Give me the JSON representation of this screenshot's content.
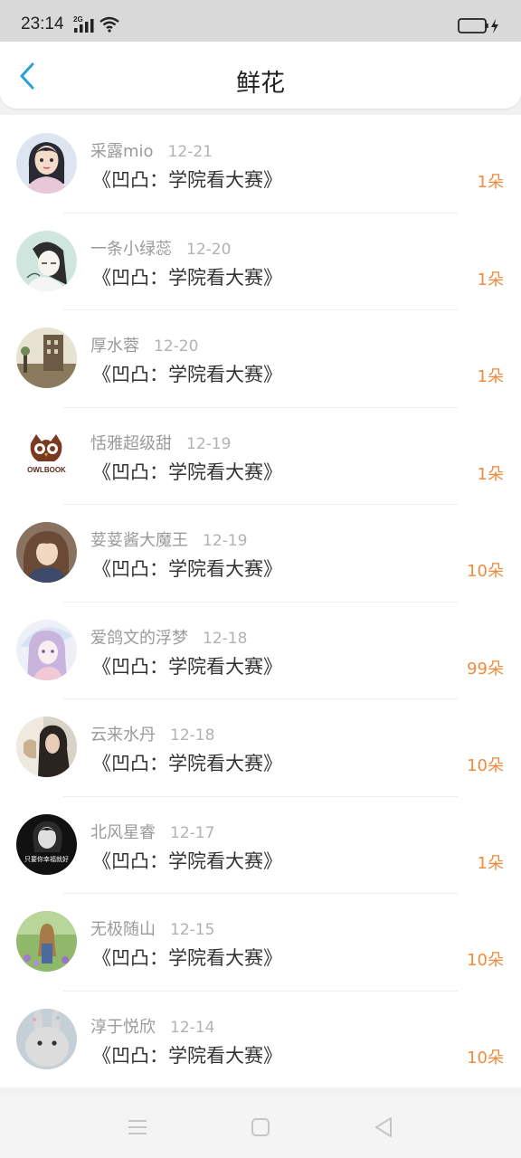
{
  "status_bar": {
    "time": "23:14",
    "network": "2G"
  },
  "header": {
    "title": "鲜花"
  },
  "items": [
    {
      "username": "采露mio",
      "date": "12-21",
      "work": "《凹凸：学院看大赛》",
      "count": "1朵"
    },
    {
      "username": "一条小绿蕊",
      "date": "12-20",
      "work": "《凹凸：学院看大赛》",
      "count": "1朵"
    },
    {
      "username": "厚水蓉",
      "date": "12-20",
      "work": "《凹凸：学院看大赛》",
      "count": "1朵"
    },
    {
      "username": "恬雅超级甜",
      "date": "12-19",
      "work": "《凹凸：学院看大赛》",
      "count": "1朵",
      "avatar_text": "OWLBOOK"
    },
    {
      "username": "荽荽酱大魔王",
      "date": "12-19",
      "work": "《凹凸：学院看大赛》",
      "count": "10朵"
    },
    {
      "username": "爱鸽文的浮梦",
      "date": "12-18",
      "work": "《凹凸：学院看大赛》",
      "count": "99朵"
    },
    {
      "username": "云来水丹",
      "date": "12-18",
      "work": "《凹凸：学院看大赛》",
      "count": "10朵"
    },
    {
      "username": "北风星睿",
      "date": "12-17",
      "work": "《凹凸：学院看大赛》",
      "count": "1朵",
      "avatar_text": "只要你幸福就好"
    },
    {
      "username": "无极随山",
      "date": "12-15",
      "work": "《凹凸：学院看大赛》",
      "count": "10朵"
    },
    {
      "username": "淳于悦欣",
      "date": "12-14",
      "work": "《凹凸：学院看大赛》",
      "count": "10朵"
    }
  ],
  "colors": {
    "accent": "#2a9fd8",
    "count": "#f08a3c"
  }
}
